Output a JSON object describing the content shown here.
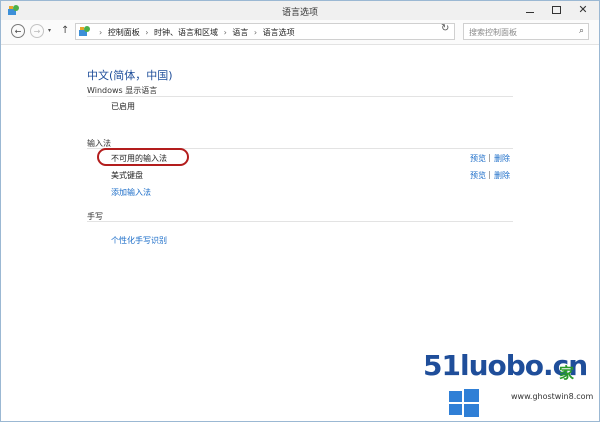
{
  "window": {
    "title": "语言选项",
    "close_glyph": "✕",
    "app_icon": "control-panel-icon"
  },
  "nav": {
    "back_glyph": "←",
    "forward_glyph": "→",
    "dropdown_glyph": "▾",
    "up_glyph": "↑"
  },
  "address": {
    "breadcrumbs": [
      "控制面板",
      "时钟、语言和区域",
      "语言",
      "语言选项"
    ],
    "separator": "›",
    "dropdown_glyph": "▾",
    "refresh_glyph": "↻"
  },
  "search": {
    "placeholder": "搜索控制面板",
    "icon_glyph": "⌕"
  },
  "content": {
    "language_title": "中文(简体，中国)",
    "display_language": {
      "heading": "Windows 显示语言",
      "status": "已启用"
    },
    "input_method": {
      "heading": "输入法",
      "items": [
        {
          "name": "不可用的输入法",
          "preview": "预览",
          "remove": "删除"
        },
        {
          "name": "美式键盘",
          "preview": "预览",
          "remove": "删除"
        }
      ],
      "add_link": "添加输入法",
      "pipe": "|"
    },
    "handwriting": {
      "heading": "手写",
      "link": "个性化手写识别"
    }
  },
  "watermark": {
    "logo": "51luobo.cn",
    "home": "家",
    "url": "www.ghostwin8.com"
  },
  "colors": {
    "title_blue": "#1f4e9a",
    "link_blue": "#1a6cc8",
    "highlight_red": "#b31d1d"
  }
}
